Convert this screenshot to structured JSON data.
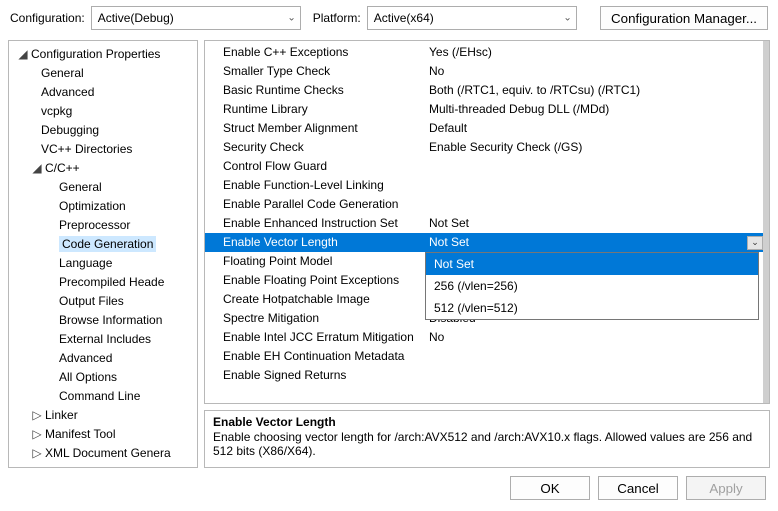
{
  "top": {
    "config_label": "Configuration:",
    "config_value": "Active(Debug)",
    "platform_label": "Platform:",
    "platform_value": "Active(x64)",
    "config_mgr": "Configuration Manager..."
  },
  "tree": {
    "root": "Configuration Properties",
    "items_lv1": [
      "General",
      "Advanced",
      "vcpkg",
      "Debugging",
      "VC++ Directories"
    ],
    "ccpp": "C/C++",
    "ccpp_items": [
      "General",
      "Optimization",
      "Preprocessor",
      "Code Generation",
      "Language",
      "Precompiled Heade",
      "Output Files",
      "Browse Information",
      "External Includes",
      "Advanced",
      "All Options",
      "Command Line"
    ],
    "after": [
      "Linker",
      "Manifest Tool",
      "XML Document Genera"
    ]
  },
  "props": [
    {
      "name": "Enable C++ Exceptions",
      "value": "Yes (/EHsc)"
    },
    {
      "name": "Smaller Type Check",
      "value": "No"
    },
    {
      "name": "Basic Runtime Checks",
      "value": "Both (/RTC1, equiv. to /RTCsu) (/RTC1)"
    },
    {
      "name": "Runtime Library",
      "value": "Multi-threaded Debug DLL (/MDd)"
    },
    {
      "name": "Struct Member Alignment",
      "value": "Default"
    },
    {
      "name": "Security Check",
      "value": "Enable Security Check (/GS)"
    },
    {
      "name": "Control Flow Guard",
      "value": ""
    },
    {
      "name": "Enable Function-Level Linking",
      "value": ""
    },
    {
      "name": "Enable Parallel Code Generation",
      "value": ""
    },
    {
      "name": "Enable Enhanced Instruction Set",
      "value": "Not Set"
    },
    {
      "name": "Enable Vector Length",
      "value": "Not Set"
    },
    {
      "name": "Floating Point Model",
      "value": ""
    },
    {
      "name": "Enable Floating Point Exceptions",
      "value": ""
    },
    {
      "name": "Create Hotpatchable Image",
      "value": ""
    },
    {
      "name": "Spectre Mitigation",
      "value": "Disabled"
    },
    {
      "name": "Enable Intel JCC Erratum Mitigation",
      "value": "No"
    },
    {
      "name": "Enable EH Continuation Metadata",
      "value": ""
    },
    {
      "name": "Enable Signed Returns",
      "value": ""
    }
  ],
  "selected_prop_index": 10,
  "dropdown": {
    "options": [
      "Not Set",
      "256 (/vlen=256)",
      "512 (/vlen=512)"
    ],
    "selected_index": 0
  },
  "desc": {
    "title": "Enable Vector Length",
    "body": "Enable choosing vector length for /arch:AVX512 and /arch:AVX10.x flags. Allowed values are 256 and 512 bits (X86/X64)."
  },
  "footer": {
    "ok": "OK",
    "cancel": "Cancel",
    "apply": "Apply"
  }
}
